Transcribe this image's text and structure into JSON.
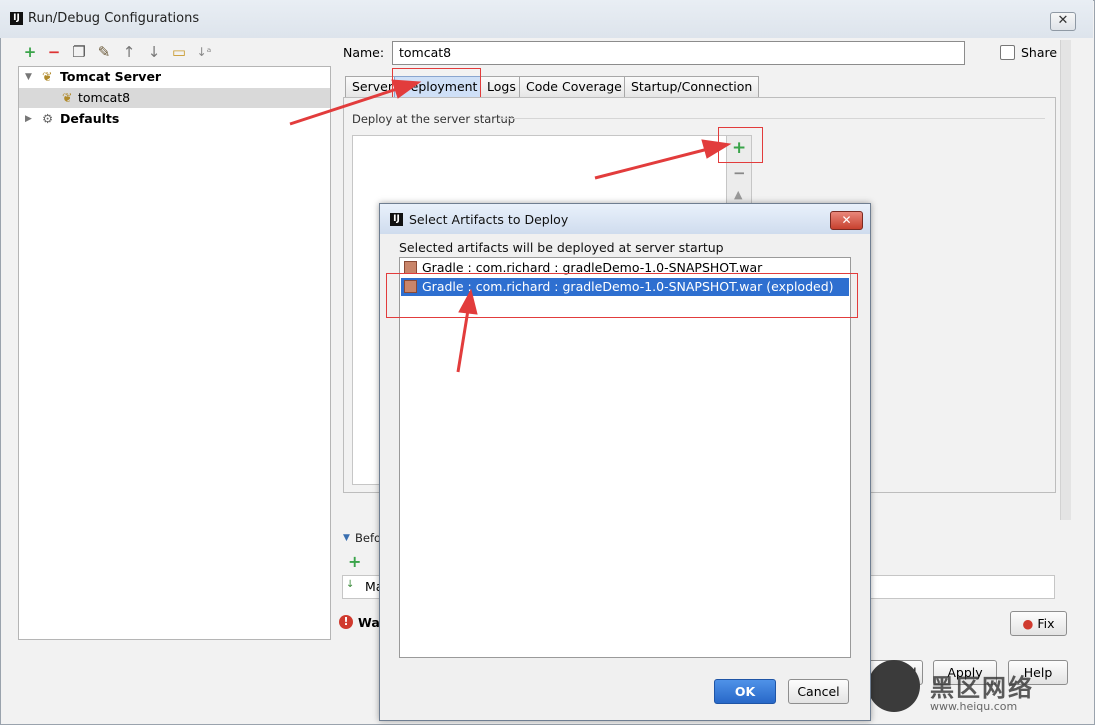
{
  "window": {
    "title": "Run/Debug Configurations",
    "app_icon": "IJ",
    "close_label": "✕"
  },
  "toolbar": {
    "icons": [
      "add-icon",
      "remove-icon",
      "copy-icon",
      "wrench-icon",
      "move-up-icon",
      "move-down-icon",
      "folder-icon",
      "sort-icon"
    ]
  },
  "tree": {
    "items": [
      {
        "label": "Tomcat Server",
        "icon": "tomcat-icon"
      },
      {
        "label": "tomcat8",
        "icon": "tomcat-icon"
      },
      {
        "label": "Defaults",
        "icon": "wrench-icon"
      }
    ]
  },
  "form": {
    "name_label": "Name:",
    "name_value": "tomcat8",
    "share_label": "Share",
    "tabs": [
      "Server",
      "Deployment",
      "Logs",
      "Code Coverage",
      "Startup/Connection"
    ],
    "active_tab": "Deployment",
    "deploy_section_label": "Deploy at the server startup",
    "before_label": "Befo",
    "before_item": "Ma",
    "warning_label": "Wa",
    "fix_label": "Fix",
    "cancel_label": "Cancel",
    "apply_label": "Apply",
    "help_label": "Help"
  },
  "dialog": {
    "title": "Select Artifacts to Deploy",
    "subtitle": "Selected artifacts will be deployed at server startup",
    "artifacts": [
      "Gradle : com.richard : gradleDemo-1.0-SNAPSHOT.war",
      "Gradle : com.richard : gradleDemo-1.0-SNAPSHOT.war (exploded)"
    ],
    "selected_index": 1,
    "ok_label": "OK",
    "cancel_label": "Cancel"
  },
  "watermark": {
    "text": "黑区网络",
    "url": "www.heiqu.com"
  },
  "colors": {
    "annotation": "#e23c3c",
    "selection": "#2e6fd0",
    "add": "#3aa44a"
  }
}
